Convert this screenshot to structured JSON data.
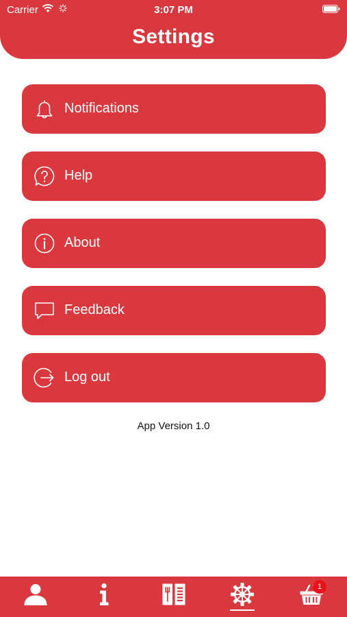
{
  "status_bar": {
    "carrier": "Carrier",
    "time": "3:07 PM"
  },
  "header": {
    "title": "Settings"
  },
  "menu": {
    "items": [
      {
        "label": "Notifications",
        "icon": "bell-icon"
      },
      {
        "label": "Help",
        "icon": "help-icon"
      },
      {
        "label": "About",
        "icon": "info-icon"
      },
      {
        "label": "Feedback",
        "icon": "feedback-icon"
      },
      {
        "label": "Log out",
        "icon": "logout-icon"
      }
    ]
  },
  "app_version": "App Version 1.0",
  "tabbar": {
    "tabs": [
      {
        "icon": "profile-icon"
      },
      {
        "icon": "info-icon"
      },
      {
        "icon": "menu-book-icon"
      },
      {
        "icon": "settings-icon",
        "selected": true
      },
      {
        "icon": "basket-icon",
        "badge": "1"
      }
    ]
  },
  "colors": {
    "accent": "#d9393e",
    "badge": "#e8141c",
    "text_on_accent": "#ffffff"
  }
}
